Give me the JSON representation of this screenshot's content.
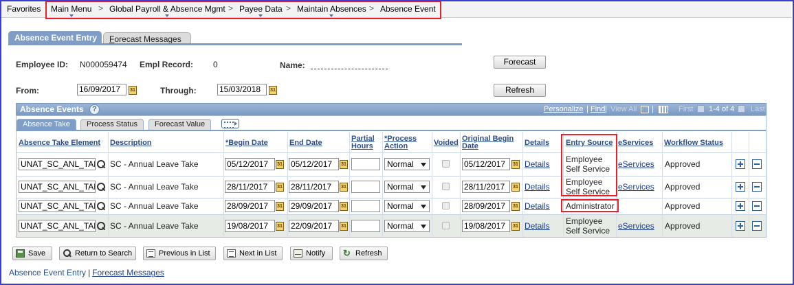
{
  "nav": {
    "favorites": "Favorites",
    "breadcrumb": [
      "Main Menu",
      "Global Payroll & Absence Mgmt",
      "Payee Data",
      "Maintain Absences",
      "Absence Event"
    ],
    "separator": ">"
  },
  "page_tabs": {
    "absence_event_entry": "Absence Event Entry",
    "forecast_messages": "Forecast Messages"
  },
  "header": {
    "employee_id_label": "Employee ID:",
    "employee_id": "N000059474",
    "empl_record_label": "Empl Record:",
    "empl_record": "0",
    "name_label": "Name:",
    "from_label": "From:",
    "from_date": "16/09/2017",
    "through_label": "Through:",
    "through_date": "15/03/2018",
    "forecast_button": "Forecast",
    "refresh_button": "Refresh"
  },
  "grid": {
    "title": "Absence Events",
    "personalize": "Personalize",
    "find": "Find",
    "view_all": "View All",
    "first": "First",
    "range": "1-4 of 4",
    "last": "Last",
    "tabs": [
      "Absence Take",
      "Process Status",
      "Forecast Value"
    ],
    "columns": {
      "element": "Absence Take Element",
      "description": "Description",
      "begin": "*Begin Date",
      "end": "End Date",
      "partial": "Partial Hours",
      "process": "*Process Action",
      "voided": "Voided",
      "orig_begin": "Original Begin Date",
      "details": "Details",
      "entry_source": "Entry Source",
      "eservices": "eServices",
      "workflow": "Workflow Status"
    },
    "rows": [
      {
        "element": "UNAT_SC_ANL_TAKE",
        "description": "SC - Annual Leave Take",
        "begin": "05/12/2017",
        "end": "05/12/2017",
        "process": "Normal",
        "orig_begin": "05/12/2017",
        "details": "Details",
        "source_line1": "Employee",
        "source_line2": "Self Service",
        "eservices": "eServices",
        "workflow": "Approved"
      },
      {
        "element": "UNAT_SC_ANL_TAKE",
        "description": "SC - Annual Leave Take",
        "begin": "28/11/2017",
        "end": "28/11/2017",
        "process": "Normal",
        "orig_begin": "28/11/2017",
        "details": "Details",
        "source_line1": "Employee",
        "source_line2": "Self Service",
        "eservices": "eServices",
        "workflow": "Approved"
      },
      {
        "element": "UNAT_SC_ANL_TAKE",
        "description": "SC - Annual Leave Take",
        "begin": "28/09/2017",
        "end": "29/09/2017",
        "process": "Normal",
        "orig_begin": "28/09/2017",
        "details": "Details",
        "source_line1": "Administrator",
        "source_line2": "",
        "eservices": "",
        "workflow": "Approved"
      },
      {
        "element": "UNAT_SC_ANL_TAKE",
        "description": "SC - Annual Leave Take",
        "begin": "19/08/2017",
        "end": "22/09/2017",
        "process": "Normal",
        "orig_begin": "19/08/2017",
        "details": "Details",
        "source_line1": "Employee",
        "source_line2": "Self Service",
        "eservices": "eServices",
        "workflow": "Approved"
      }
    ]
  },
  "toolbar": {
    "save": "Save",
    "return_to_search": "Return to Search",
    "previous_in_list": "Previous in List",
    "next_in_list": "Next in List",
    "notify": "Notify",
    "refresh": "Refresh"
  },
  "footer": {
    "current": "Absence Event Entry",
    "forecast_messages": "Forecast Messages"
  },
  "icons": {
    "calendar": "calendar-icon",
    "lookup": "magnifier-icon",
    "help": "help-icon",
    "add_row": "plus-icon",
    "delete_row": "minus-icon"
  },
  "colors": {
    "accent": "#7e9dc7",
    "link": "#1d3f8c",
    "highlight": "#e8202a",
    "frame": "#3a3fcf"
  }
}
